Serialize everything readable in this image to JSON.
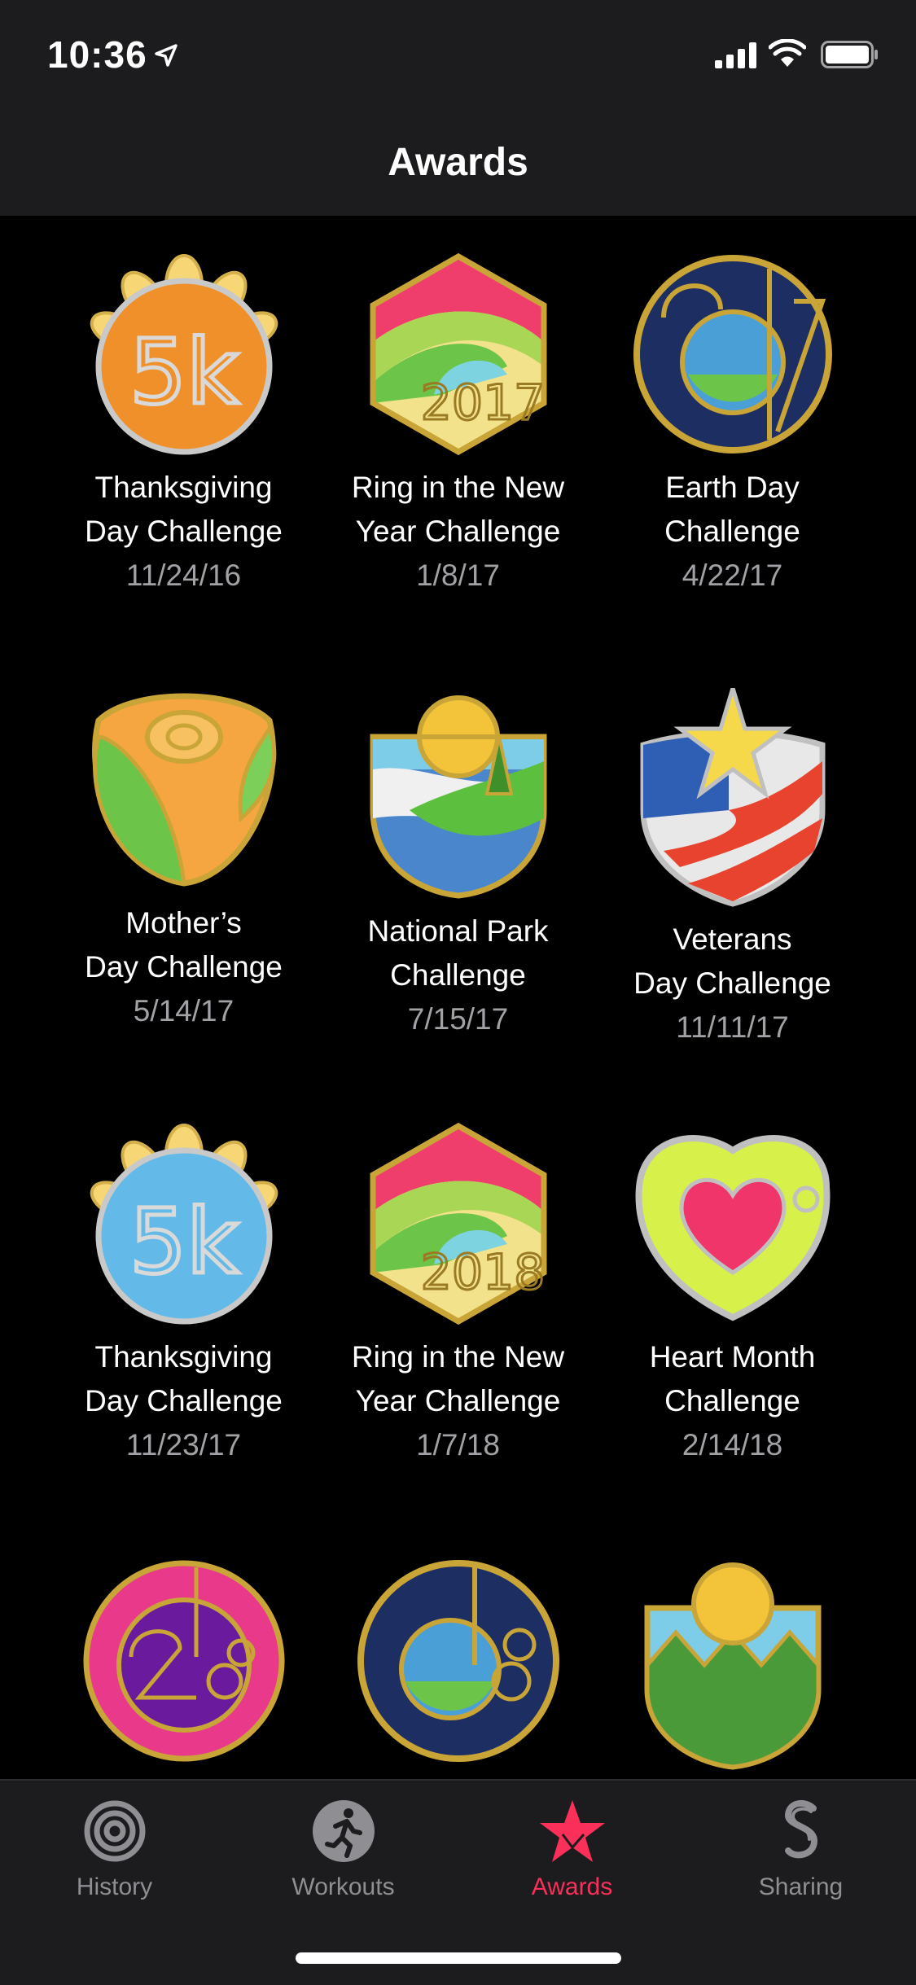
{
  "status": {
    "time": "10:36"
  },
  "nav": {
    "title": "Awards"
  },
  "awards": [
    {
      "name": "Thanksgiving\nDay Challenge",
      "date": "11/24/16",
      "icon": "thanksgiving-5k-orange-badge-icon"
    },
    {
      "name": "Ring in the New\nYear Challenge",
      "date": "1/8/17",
      "icon": "new-year-2017-hexagon-badge-icon"
    },
    {
      "name": "Earth Day\nChallenge",
      "date": "4/22/17",
      "icon": "earth-day-2017-badge-icon"
    },
    {
      "name": "Mother’s\nDay Challenge",
      "date": "5/14/17",
      "icon": "mothers-day-rose-badge-icon"
    },
    {
      "name": "National Park\nChallenge",
      "date": "7/15/17",
      "icon": "national-park-badge-icon"
    },
    {
      "name": "Veterans\nDay Challenge",
      "date": "11/11/17",
      "icon": "veterans-day-flag-badge-icon"
    },
    {
      "name": "Thanksgiving\nDay Challenge",
      "date": "11/23/17",
      "icon": "thanksgiving-5k-blue-badge-icon"
    },
    {
      "name": "Ring in the New\nYear Challenge",
      "date": "1/7/18",
      "icon": "new-year-2018-hexagon-badge-icon"
    },
    {
      "name": "Heart Month\nChallenge",
      "date": "2/14/18",
      "icon": "heart-month-badge-icon"
    },
    {
      "name": "",
      "date": "",
      "icon": "pink-2018-badge-icon"
    },
    {
      "name": "",
      "date": "",
      "icon": "earth-day-2018-badge-icon"
    },
    {
      "name": "",
      "date": "",
      "icon": "mountain-sun-badge-icon"
    }
  ],
  "tabs": [
    {
      "label": "History",
      "icon": "rings-icon",
      "active": false
    },
    {
      "label": "Workouts",
      "icon": "runner-icon",
      "active": false
    },
    {
      "label": "Awards",
      "icon": "star-award-icon",
      "active": true
    },
    {
      "label": "Sharing",
      "icon": "sharing-icon",
      "active": false
    }
  ],
  "colors": {
    "accent": "#fa2f5a",
    "gold": "#c9a437"
  }
}
